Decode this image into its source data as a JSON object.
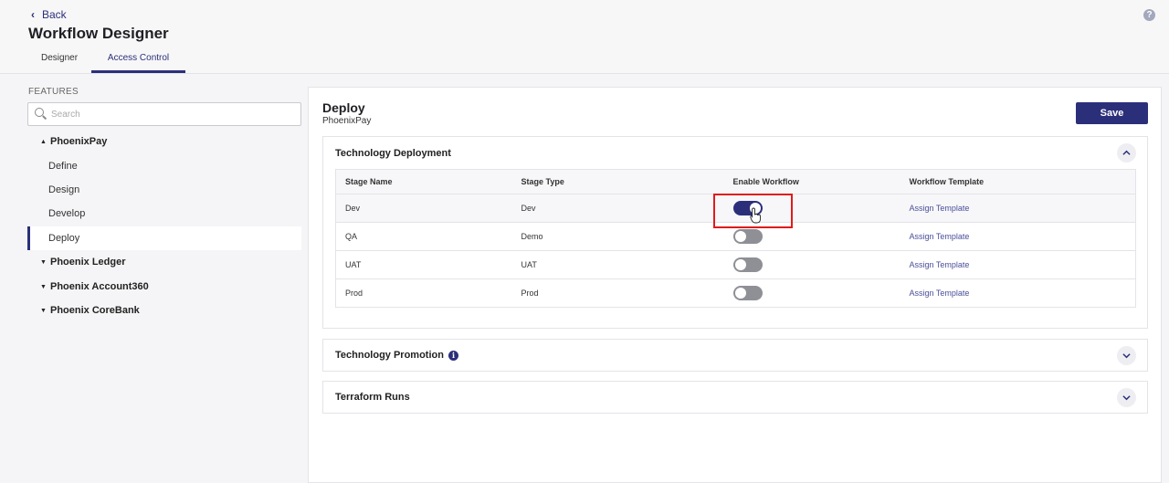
{
  "header": {
    "back_label": "Back",
    "title": "Workflow Designer",
    "help_icon": "question-icon",
    "tabs": [
      {
        "label": "Designer",
        "active": false
      },
      {
        "label": "Access Control",
        "active": true
      }
    ]
  },
  "sidebar": {
    "section_label": "FEATURES",
    "search_placeholder": "Search",
    "groups": [
      {
        "label": "PhoenixPay",
        "expanded": true,
        "items": [
          "Define",
          "Design",
          "Develop",
          "Deploy"
        ],
        "active_item": "Deploy"
      },
      {
        "label": "Phoenix Ledger",
        "expanded": false
      },
      {
        "label": "Phoenix Account360",
        "expanded": false
      },
      {
        "label": "Phoenix CoreBank",
        "expanded": false
      }
    ]
  },
  "main": {
    "title": "Deploy",
    "subtitle": "PhoenixPay",
    "save_label": "Save",
    "panels": [
      {
        "title": "Technology Deployment",
        "expanded": true
      },
      {
        "title": "Technology Promotion",
        "expanded": false,
        "info_icon": "info-icon"
      },
      {
        "title": "Terraform Runs",
        "expanded": false
      }
    ],
    "table": {
      "headers": [
        "Stage Name",
        "Stage Type",
        "Enable Workflow",
        "Workflow Template"
      ],
      "rows": [
        {
          "stage_name": "Dev",
          "stage_type": "Dev",
          "enabled": true,
          "template": "Assign Template"
        },
        {
          "stage_name": "QA",
          "stage_type": "Demo",
          "enabled": false,
          "template": "Assign Template"
        },
        {
          "stage_name": "UAT",
          "stage_type": "UAT",
          "enabled": false,
          "template": "Assign Template"
        },
        {
          "stage_name": "Prod",
          "stage_type": "Prod",
          "enabled": false,
          "template": "Assign Template"
        }
      ]
    }
  },
  "colors": {
    "accent": "#2b2f7a",
    "highlight": "#e01b1b",
    "toggle_off": "#8f9095"
  }
}
